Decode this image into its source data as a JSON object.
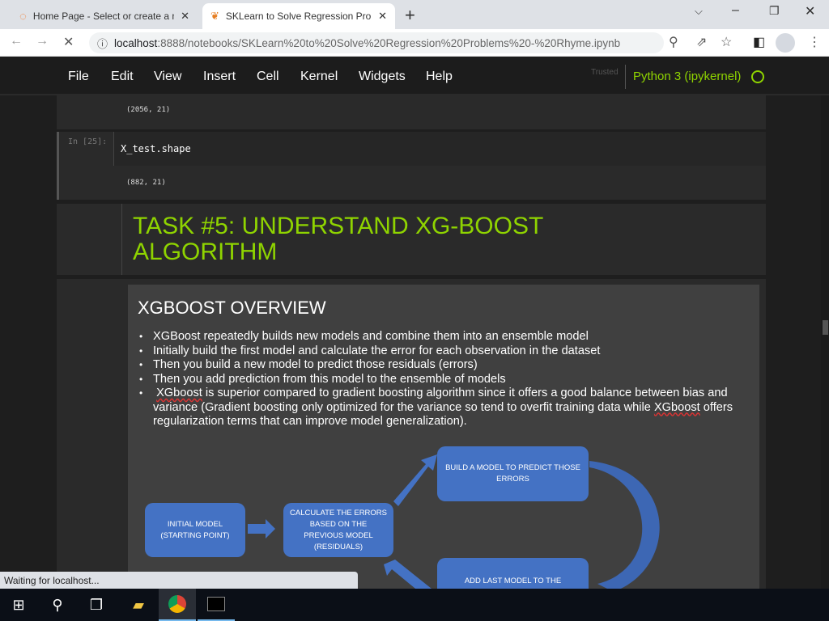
{
  "browser": {
    "tabs": [
      {
        "title": "Home Page - Select or create a n",
        "active": false
      },
      {
        "title": "SKLearn to Solve Regression Prob",
        "active": true
      }
    ],
    "url_host": "localhost",
    "url_rest": ":8888/notebooks/SKLearn%20to%20Solve%20Regression%20Problems%20-%20Rhyme.ipynb",
    "status": "Waiting for localhost..."
  },
  "jupyter": {
    "menu": [
      "File",
      "Edit",
      "View",
      "Insert",
      "Cell",
      "Kernel",
      "Widgets",
      "Help"
    ],
    "trusted": "Trusted",
    "kernel": "Python 3 (ipykernel)",
    "accent": "#8fd400"
  },
  "cells": {
    "prev_output": "(2056, 21)",
    "prompt": "In [25]:",
    "code": "X_test.shape",
    "output": "(882, 21)",
    "heading": "TASK #5: UNDERSTAND XG-BOOST ALGORITHM"
  },
  "slide": {
    "title": "XGBOOST OVERVIEW",
    "bullets": [
      "XGBoost repeatedly builds new models and combine them into an ensemble model",
      "Initially build the first model and calculate the error for each observation in the dataset",
      "Then you build a new model to predict those residuals (errors)",
      "Then you add prediction from this model to the ensemble of models"
    ],
    "b5_word1": "XGboost",
    "b5_text1": " is superior compared to gradient boosting algorithm since it offers a good balance between bias and variance (Gradient boosting only optimized for the variance so tend to overfit training data while ",
    "b5_word2": "XGboost",
    "b5_text2": " offers regularization terms that can improve model generalization).",
    "boxes": {
      "initial": "INITIAL MODEL (STARTING POINT)",
      "calc": "CALCULATE THE ERRORS BASED ON THE PREVIOUS MODEL (RESIDUALS)",
      "build": "BUILD A MODEL TO PREDICT THOSE ERRORS",
      "add": "ADD LAST MODEL TO THE"
    }
  }
}
